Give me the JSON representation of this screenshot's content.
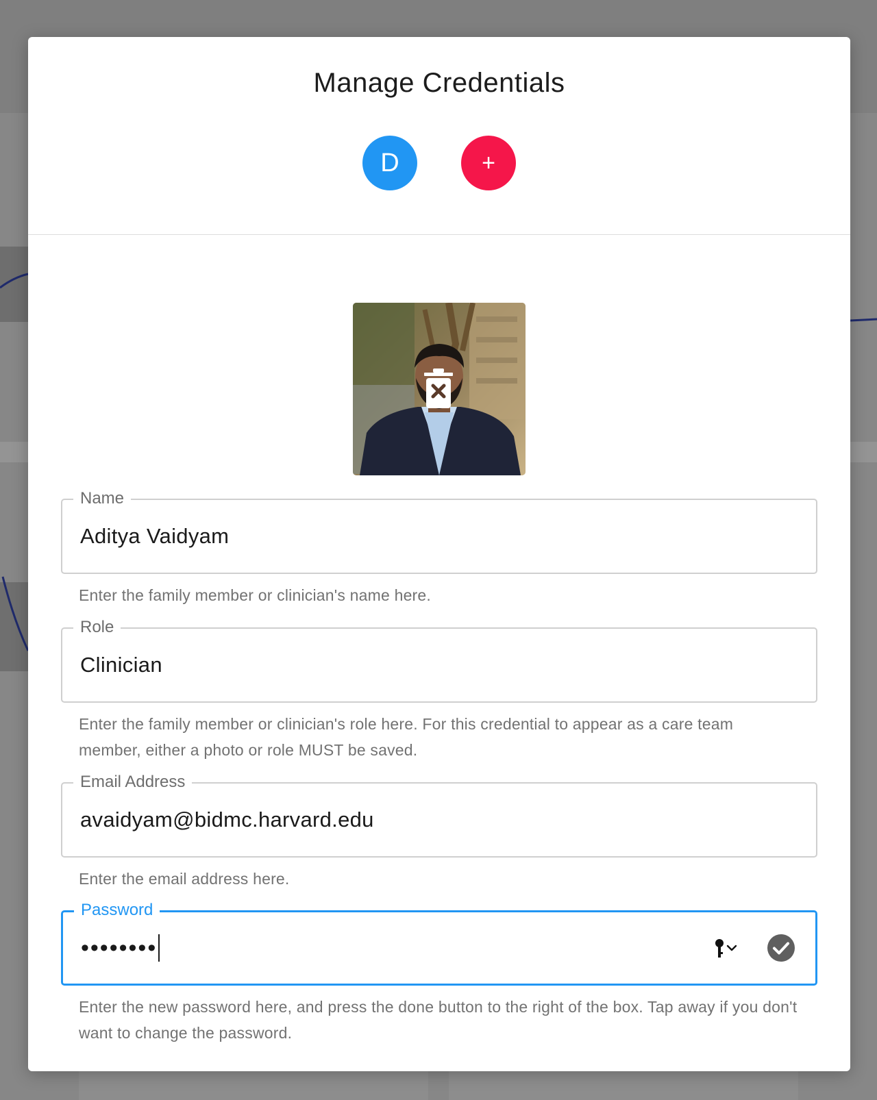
{
  "dialog": {
    "title": "Manage Credentials",
    "avatars": [
      {
        "label": "D",
        "color": "#2196f3"
      },
      {
        "label": "+",
        "color": "#f5164a"
      }
    ]
  },
  "photo": {
    "icon": "trash-remove-icon"
  },
  "fields": {
    "name": {
      "label": "Name",
      "value": "Aditya Vaidyam",
      "helper": "Enter the family member or clinician's name here."
    },
    "role": {
      "label": "Role",
      "value": "Clinician",
      "helper": "Enter the family member or clinician's role here. For this credential to appear as a care team member, either a photo or role MUST be saved."
    },
    "email": {
      "label": "Email Address",
      "value": "avaidyam@bidmc.harvard.edu",
      "helper": "Enter the email address here."
    },
    "password": {
      "label": "Password",
      "value": "••••••••",
      "helper": "Enter the new password here, and press the done button to the right of the box. Tap away if you don't want to change the password.",
      "key_icon": "key-chevron-icon",
      "done_icon": "checkmark-circle-icon"
    }
  },
  "colors": {
    "accent": "#2196f3",
    "add": "#f5164a",
    "overlay": "#7f7f7f"
  }
}
